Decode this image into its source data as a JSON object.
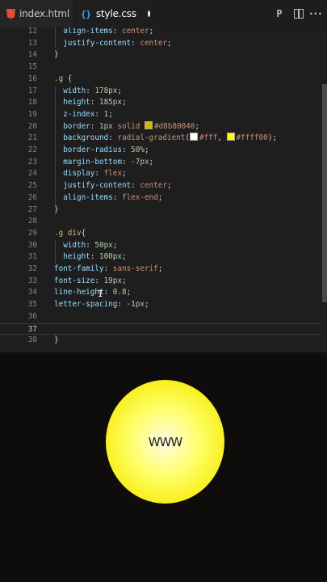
{
  "tabs": [
    {
      "label": "index.html",
      "icon": "html-file-icon",
      "active": false
    },
    {
      "label": "style.css",
      "icon": "css-file-icon",
      "active": true,
      "modified": true
    }
  ],
  "editor": {
    "lines": [
      {
        "n": "12",
        "indent": 2,
        "tokens": [
          {
            "t": "align-items",
            "c": "prop"
          },
          {
            "t": ": ",
            "c": "brace"
          },
          {
            "t": "center",
            "c": "val"
          },
          {
            "t": ";",
            "c": "brace"
          }
        ]
      },
      {
        "n": "13",
        "indent": 2,
        "tokens": [
          {
            "t": "justify-content",
            "c": "prop"
          },
          {
            "t": ": ",
            "c": "brace"
          },
          {
            "t": "center",
            "c": "val"
          },
          {
            "t": ";",
            "c": "brace"
          }
        ]
      },
      {
        "n": "14",
        "indent": 0,
        "tokens": [
          {
            "t": "}",
            "c": "brace"
          }
        ]
      },
      {
        "n": "15",
        "indent": 0,
        "tokens": []
      },
      {
        "n": "16",
        "indent": 0,
        "tokens": [
          {
            "t": ".g",
            "c": "sel"
          },
          {
            "t": " {",
            "c": "brace"
          }
        ]
      },
      {
        "n": "17",
        "indent": 2,
        "tokens": [
          {
            "t": "width",
            "c": "prop"
          },
          {
            "t": ": ",
            "c": "brace"
          },
          {
            "t": "178px",
            "c": "num"
          },
          {
            "t": ";",
            "c": "brace"
          }
        ]
      },
      {
        "n": "18",
        "indent": 2,
        "tokens": [
          {
            "t": "height",
            "c": "prop"
          },
          {
            "t": ": ",
            "c": "brace"
          },
          {
            "t": "185px",
            "c": "num"
          },
          {
            "t": ";",
            "c": "brace"
          }
        ]
      },
      {
        "n": "19",
        "indent": 2,
        "tokens": [
          {
            "t": "z-index",
            "c": "prop"
          },
          {
            "t": ": ",
            "c": "brace"
          },
          {
            "t": "1",
            "c": "num"
          },
          {
            "t": ";",
            "c": "brace"
          }
        ]
      },
      {
        "n": "20",
        "indent": 2,
        "tokens": [
          {
            "t": "border",
            "c": "prop"
          },
          {
            "t": ": ",
            "c": "brace"
          },
          {
            "t": "1px",
            "c": "num"
          },
          {
            "t": " solid ",
            "c": "val"
          },
          {
            "sw": "#d8b800"
          },
          {
            "t": "#d8b80040",
            "c": "val"
          },
          {
            "t": ";",
            "c": "brace"
          }
        ]
      },
      {
        "n": "21",
        "indent": 2,
        "tokens": [
          {
            "t": "background",
            "c": "prop"
          },
          {
            "t": ": ",
            "c": "brace"
          },
          {
            "t": "radial-gradient",
            "c": "val"
          },
          {
            "t": "(",
            "c": "brace"
          },
          {
            "sw": "#ffffff"
          },
          {
            "t": "#fff",
            "c": "val"
          },
          {
            "t": ", ",
            "c": "brace"
          },
          {
            "sw": "#ffff00"
          },
          {
            "t": "#ffff00",
            "c": "val"
          },
          {
            "t": ");",
            "c": "brace"
          }
        ]
      },
      {
        "n": "22",
        "indent": 2,
        "tokens": [
          {
            "t": "border-radius",
            "c": "prop"
          },
          {
            "t": ": ",
            "c": "brace"
          },
          {
            "t": "50%",
            "c": "num"
          },
          {
            "t": ";",
            "c": "brace"
          }
        ]
      },
      {
        "n": "23",
        "indent": 2,
        "tokens": [
          {
            "t": "margin-bottom",
            "c": "prop"
          },
          {
            "t": ": ",
            "c": "brace"
          },
          {
            "t": "-7px",
            "c": "num"
          },
          {
            "t": ";",
            "c": "brace"
          }
        ]
      },
      {
        "n": "24",
        "indent": 2,
        "tokens": [
          {
            "t": "display",
            "c": "prop"
          },
          {
            "t": ": ",
            "c": "brace"
          },
          {
            "t": "flex",
            "c": "val"
          },
          {
            "t": ";",
            "c": "brace"
          }
        ]
      },
      {
        "n": "25",
        "indent": 2,
        "tokens": [
          {
            "t": "justify-content",
            "c": "prop"
          },
          {
            "t": ": ",
            "c": "brace"
          },
          {
            "t": "center",
            "c": "val"
          },
          {
            "t": ";",
            "c": "brace"
          }
        ]
      },
      {
        "n": "26",
        "indent": 2,
        "tokens": [
          {
            "t": "align-items",
            "c": "prop"
          },
          {
            "t": ": ",
            "c": "brace"
          },
          {
            "t": "flex-end",
            "c": "val"
          },
          {
            "t": ";",
            "c": "brace"
          }
        ]
      },
      {
        "n": "27",
        "indent": 0,
        "tokens": [
          {
            "t": "}",
            "c": "brace"
          }
        ]
      },
      {
        "n": "28",
        "indent": 0,
        "tokens": []
      },
      {
        "n": "29",
        "indent": 0,
        "tokens": [
          {
            "t": ".g div",
            "c": "sel"
          },
          {
            "t": "{",
            "c": "brace"
          }
        ]
      },
      {
        "n": "30",
        "indent": 2,
        "tokens": [
          {
            "t": "width",
            "c": "prop"
          },
          {
            "t": ": ",
            "c": "brace"
          },
          {
            "t": "50px",
            "c": "num"
          },
          {
            "t": ";",
            "c": "brace"
          }
        ]
      },
      {
        "n": "31",
        "indent": 2,
        "tokens": [
          {
            "t": "height",
            "c": "prop"
          },
          {
            "t": ": ",
            "c": "brace"
          },
          {
            "t": "100px",
            "c": "num"
          },
          {
            "t": ";",
            "c": "brace"
          }
        ]
      },
      {
        "n": "32",
        "indent": 0,
        "tokens": [
          {
            "t": "font-family",
            "c": "prop"
          },
          {
            "t": ": ",
            "c": "brace"
          },
          {
            "t": "sans-serif",
            "c": "val"
          },
          {
            "t": ";",
            "c": "brace"
          }
        ]
      },
      {
        "n": "33",
        "indent": 0,
        "tokens": [
          {
            "t": "font-size",
            "c": "prop"
          },
          {
            "t": ": ",
            "c": "brace"
          },
          {
            "t": "19px",
            "c": "num"
          },
          {
            "t": ";",
            "c": "brace"
          }
        ]
      },
      {
        "n": "34",
        "indent": 0,
        "tokens": [
          {
            "t": "line-height",
            "c": "prop"
          },
          {
            "t": ": ",
            "c": "brace"
          },
          {
            "t": "0.8",
            "c": "num"
          },
          {
            "t": ";",
            "c": "brace"
          }
        ]
      },
      {
        "n": "35",
        "indent": 0,
        "tokens": [
          {
            "t": "letter-spacing",
            "c": "prop"
          },
          {
            "t": ": ",
            "c": "brace"
          },
          {
            "t": "-1px",
            "c": "num"
          },
          {
            "t": ";",
            "c": "brace"
          }
        ]
      },
      {
        "n": "36",
        "indent": 0,
        "tokens": []
      },
      {
        "n": "37",
        "indent": 0,
        "tokens": [],
        "current": true
      },
      {
        "n": "38",
        "indent": 0,
        "tokens": [
          {
            "t": "}",
            "c": "brace"
          }
        ]
      }
    ]
  },
  "preview": {
    "ball_text": "WWW"
  }
}
